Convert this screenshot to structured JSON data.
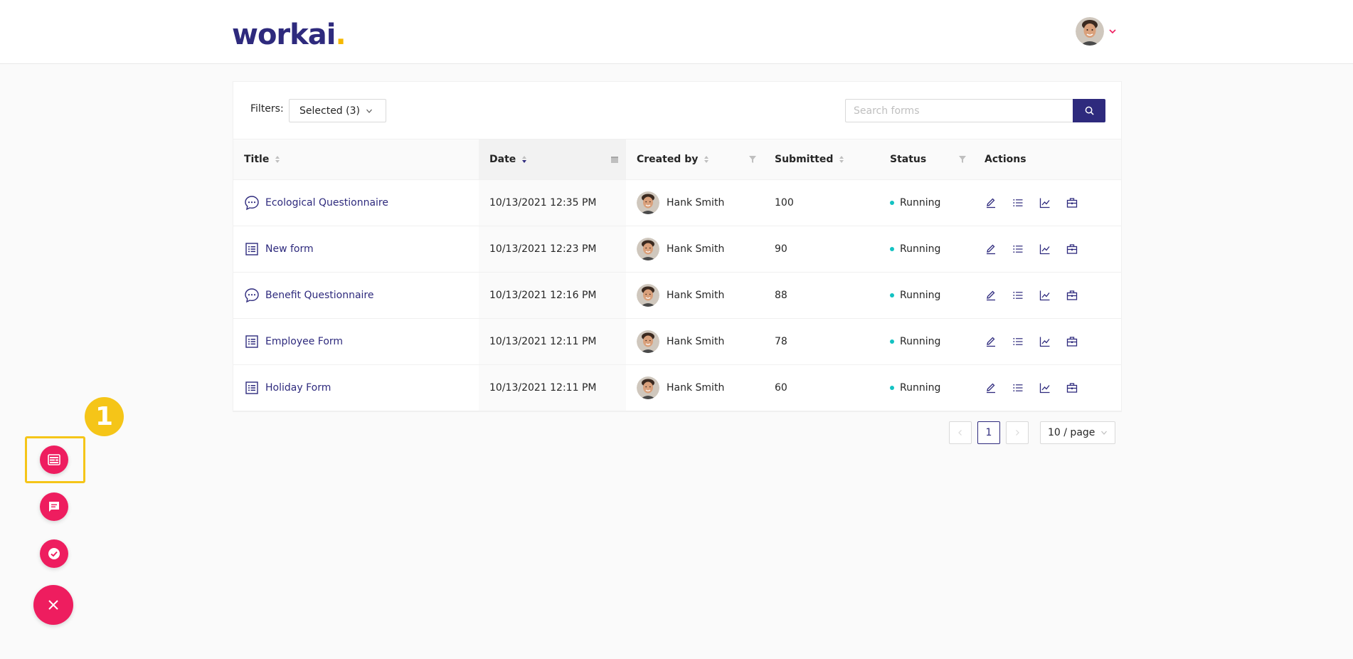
{
  "header": {
    "logo_text": "workai",
    "logo_dot": ".",
    "user_avatar": "user-avatar",
    "menu_icon": "chevron-down-icon"
  },
  "filters": {
    "label": "Filters:",
    "selected_label": "Selected (3)"
  },
  "search": {
    "placeholder": "Search forms",
    "icon": "search-icon"
  },
  "table": {
    "columns": [
      "Title",
      "Date",
      "Created by",
      "Submitted",
      "Status",
      "Actions"
    ],
    "rows": [
      {
        "type_icon": "chat-bubble-icon",
        "title": "Ecological Questionnaire",
        "date": "10/13/2021 12:35 PM",
        "creator": "Hank Smith",
        "submitted": "100",
        "status": "Running"
      },
      {
        "type_icon": "list-form-icon",
        "title": "New form",
        "date": "10/13/2021 12:23 PM",
        "creator": "Hank Smith",
        "submitted": "90",
        "status": "Running"
      },
      {
        "type_icon": "chat-bubble-icon",
        "title": "Benefit Questionnaire",
        "date": "10/13/2021 12:16 PM",
        "creator": "Hank Smith",
        "submitted": "88",
        "status": "Running"
      },
      {
        "type_icon": "list-form-icon",
        "title": "Employee Form",
        "date": "10/13/2021 12:11 PM",
        "creator": "Hank Smith",
        "submitted": "78",
        "status": "Running"
      },
      {
        "type_icon": "list-form-icon",
        "title": "Holiday Form",
        "date": "10/13/2021 12:11 PM",
        "creator": "Hank Smith",
        "submitted": "60",
        "status": "Running"
      }
    ],
    "action_icons": [
      "edit-icon",
      "list-icon",
      "chart-icon",
      "briefcase-icon"
    ]
  },
  "pagination": {
    "current_page": "1",
    "page_size": "10 / page"
  },
  "fab_menu": {
    "step_number": "1",
    "items": [
      "forms-icon",
      "chat-icon",
      "check-circle-icon",
      "close-icon"
    ]
  },
  "colors": {
    "brand": "#2e2a7d",
    "accent": "#ee1d5f",
    "highlight": "#f5c518",
    "status_running": "#13c2c2"
  }
}
